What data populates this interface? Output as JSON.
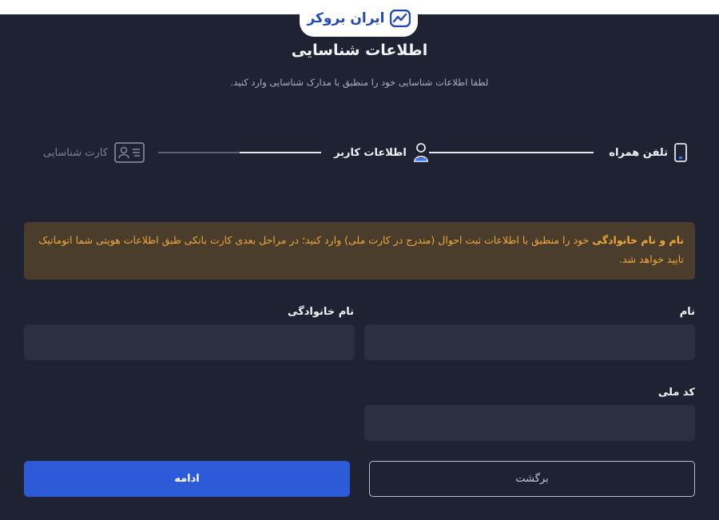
{
  "brand": {
    "logo_text": "ایران بروکر",
    "accent": "#2348b8"
  },
  "header": {
    "title": "اطلاعات شناسایی",
    "subtitle": "لطفا اطلاعات شناسایی خود را منطبق با مدارک شناسایی وارد کنید."
  },
  "stepper": {
    "steps": [
      {
        "label": "تلفن همراه",
        "icon": "mobile-phone-icon",
        "state": "completed"
      },
      {
        "label": "اطلاعات کاربر",
        "icon": "user-icon",
        "state": "active"
      },
      {
        "label": "کارت شناسایی",
        "icon": "id-card-icon",
        "state": "pending"
      }
    ]
  },
  "notice": {
    "bold": "نام و نام خانوادگی",
    "text": " خود را منطبق با اطلاعات ثبت احوال (مندرج در کارت ملی) وارد کنید؛ در مراحل بعدی کارت بانکی طبق اطلاعات هویتی شما اتوماتیک تایید خواهد شد."
  },
  "form": {
    "first_name_label": "نام",
    "last_name_label": "نام خانوادگی",
    "national_code_label": "کد ملی",
    "first_name_value": "",
    "last_name_value": "",
    "national_code_value": ""
  },
  "actions": {
    "continue_label": "ادامه",
    "back_label": "برگشت",
    "primary_color": "#2d5ad6"
  }
}
